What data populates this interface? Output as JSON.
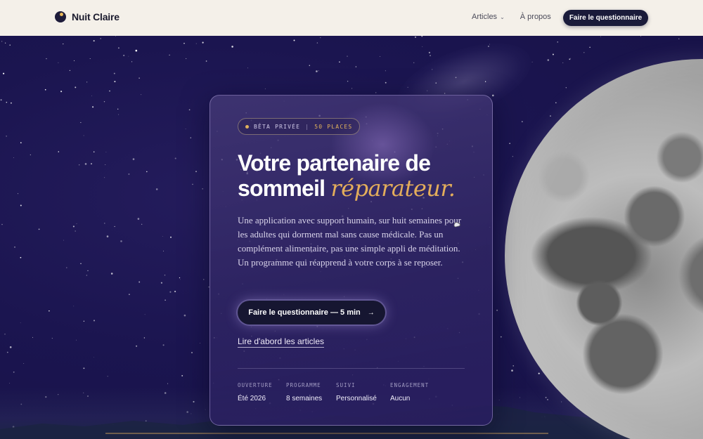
{
  "nav": {
    "brand": "Nuit Claire",
    "links": [
      {
        "label": "Articles",
        "has_dropdown": true,
        "dropdown_icon": "chevron-down-icon"
      },
      {
        "label": "À propos",
        "has_dropdown": false
      }
    ],
    "cta": "Faire le questionnaire"
  },
  "hero": {
    "badge": {
      "left": "BÊTA PRIVÉE",
      "separator": "|",
      "right": "50 PLACES",
      "dot_color": "#e0b15c"
    },
    "title_line1": "Votre partenaire de",
    "title_line2_plain": "sommeil ",
    "title_line2_accent": "réparateur.",
    "description": "Une application avec support humain, sur huit semaines pour les adultes qui dorment mal sans cause médicale. Pas un complément alimentaire, pas une simple appli de méditation. Un programme qui réapprend à votre corps à se reposer.",
    "cta": "Faire le questionnaire — 5 min",
    "cta_icon": "arrow-right-icon",
    "secondary_link": "Lire d'abord les articles",
    "stats": [
      {
        "label": "OUVERTURE",
        "value": "Été 2026"
      },
      {
        "label": "PROGRAMME",
        "value": "8 semaines"
      },
      {
        "label": "SUIVI",
        "value": "Personnalisé"
      },
      {
        "label": "ENGAGEMENT",
        "value": "Aucun"
      }
    ]
  },
  "colors": {
    "nav_bg": "#f4f0e9",
    "hero_bg": "#1b1550",
    "accent": "#e3ad5b",
    "button_dark": "#1a1b3a"
  }
}
